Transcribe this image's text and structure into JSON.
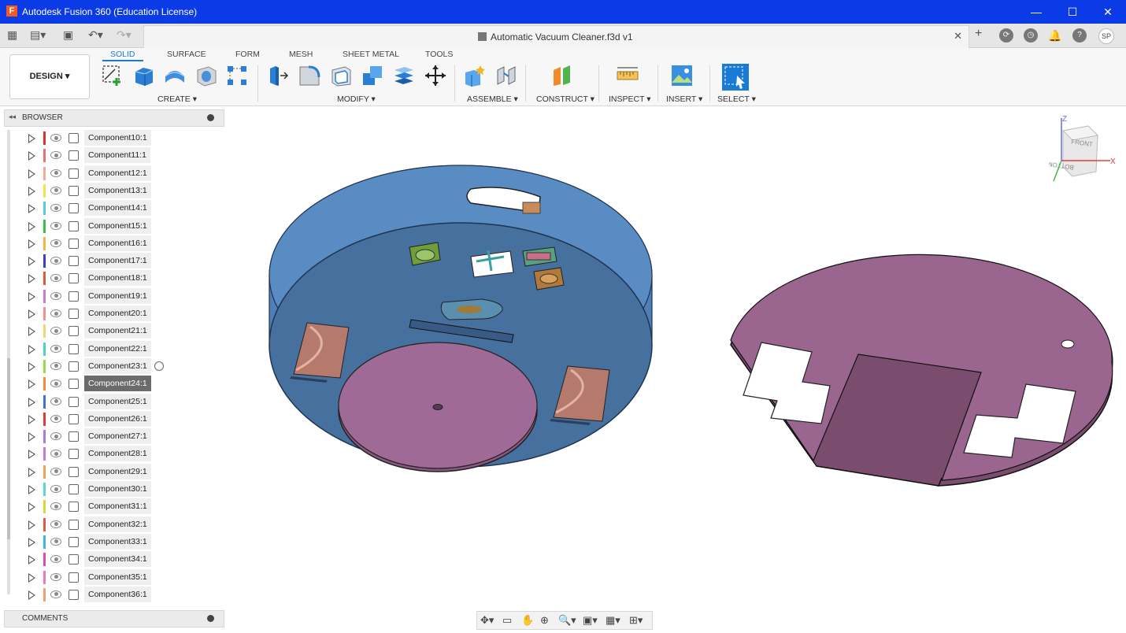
{
  "window": {
    "title": "Autodesk Fusion 360 (Education License)",
    "app_icon": "F",
    "minimize": "—",
    "maximize": "☐",
    "close": "✕"
  },
  "document": {
    "tab_title": "Automatic Vacuum Cleaner.f3d v1",
    "close": "✕",
    "user_initials": "SP"
  },
  "ribbon": {
    "workspace": "DESIGN ▾",
    "tabs": [
      "SOLID",
      "SURFACE",
      "FORM",
      "MESH",
      "SHEET METAL",
      "TOOLS"
    ],
    "active_tab": "SOLID",
    "groups": [
      {
        "label": "CREATE ▾"
      },
      {
        "label": "MODIFY ▾"
      },
      {
        "label": "ASSEMBLE ▾"
      },
      {
        "label": "CONSTRUCT ▾"
      },
      {
        "label": "INSPECT ▾"
      },
      {
        "label": "INSERT ▾"
      },
      {
        "label": "SELECT ▾"
      }
    ]
  },
  "browser": {
    "title": "BROWSER",
    "components": [
      {
        "name": "Component10:1",
        "color": "#e0312a"
      },
      {
        "name": "Component11:1",
        "color": "#e8736b"
      },
      {
        "name": "Component12:1",
        "color": "#f2a89b"
      },
      {
        "name": "Component13:1",
        "color": "#f2e34a"
      },
      {
        "name": "Component14:1",
        "color": "#56c8e8"
      },
      {
        "name": "Component15:1",
        "color": "#33c24a"
      },
      {
        "name": "Component16:1",
        "color": "#f7b346"
      },
      {
        "name": "Component17:1",
        "color": "#3b3fcf"
      },
      {
        "name": "Component18:1",
        "color": "#e0583a"
      },
      {
        "name": "Component19:1",
        "color": "#d07ad8"
      },
      {
        "name": "Component20:1",
        "color": "#f48f8a"
      },
      {
        "name": "Component21:1",
        "color": "#f5d274"
      },
      {
        "name": "Component22:1",
        "color": "#4fd1c5"
      },
      {
        "name": "Component23:1",
        "color": "#9bd84a"
      },
      {
        "name": "Component24:1",
        "color": "#f28a3a"
      },
      {
        "name": "Component25:1",
        "color": "#3a73e0"
      },
      {
        "name": "Component26:1",
        "color": "#e03a3a"
      },
      {
        "name": "Component27:1",
        "color": "#b07ad8"
      },
      {
        "name": "Component28:1",
        "color": "#c97ad8"
      },
      {
        "name": "Component29:1",
        "color": "#f4a15a"
      },
      {
        "name": "Component30:1",
        "color": "#5ad8d0"
      },
      {
        "name": "Component31:1",
        "color": "#d6d83a"
      },
      {
        "name": "Component32:1",
        "color": "#e05a4a"
      },
      {
        "name": "Component33:1",
        "color": "#3ab8e0"
      },
      {
        "name": "Component34:1",
        "color": "#e04ab0"
      },
      {
        "name": "Component35:1",
        "color": "#f07ab0"
      },
      {
        "name": "Component36:1",
        "color": "#f2a07a"
      }
    ],
    "selected": "Component24:1"
  },
  "comments": {
    "title": "COMMENTS"
  },
  "viewcube": {
    "front": "FRONT",
    "bottom": "BOTTOM",
    "x": "X",
    "z": "Z"
  }
}
